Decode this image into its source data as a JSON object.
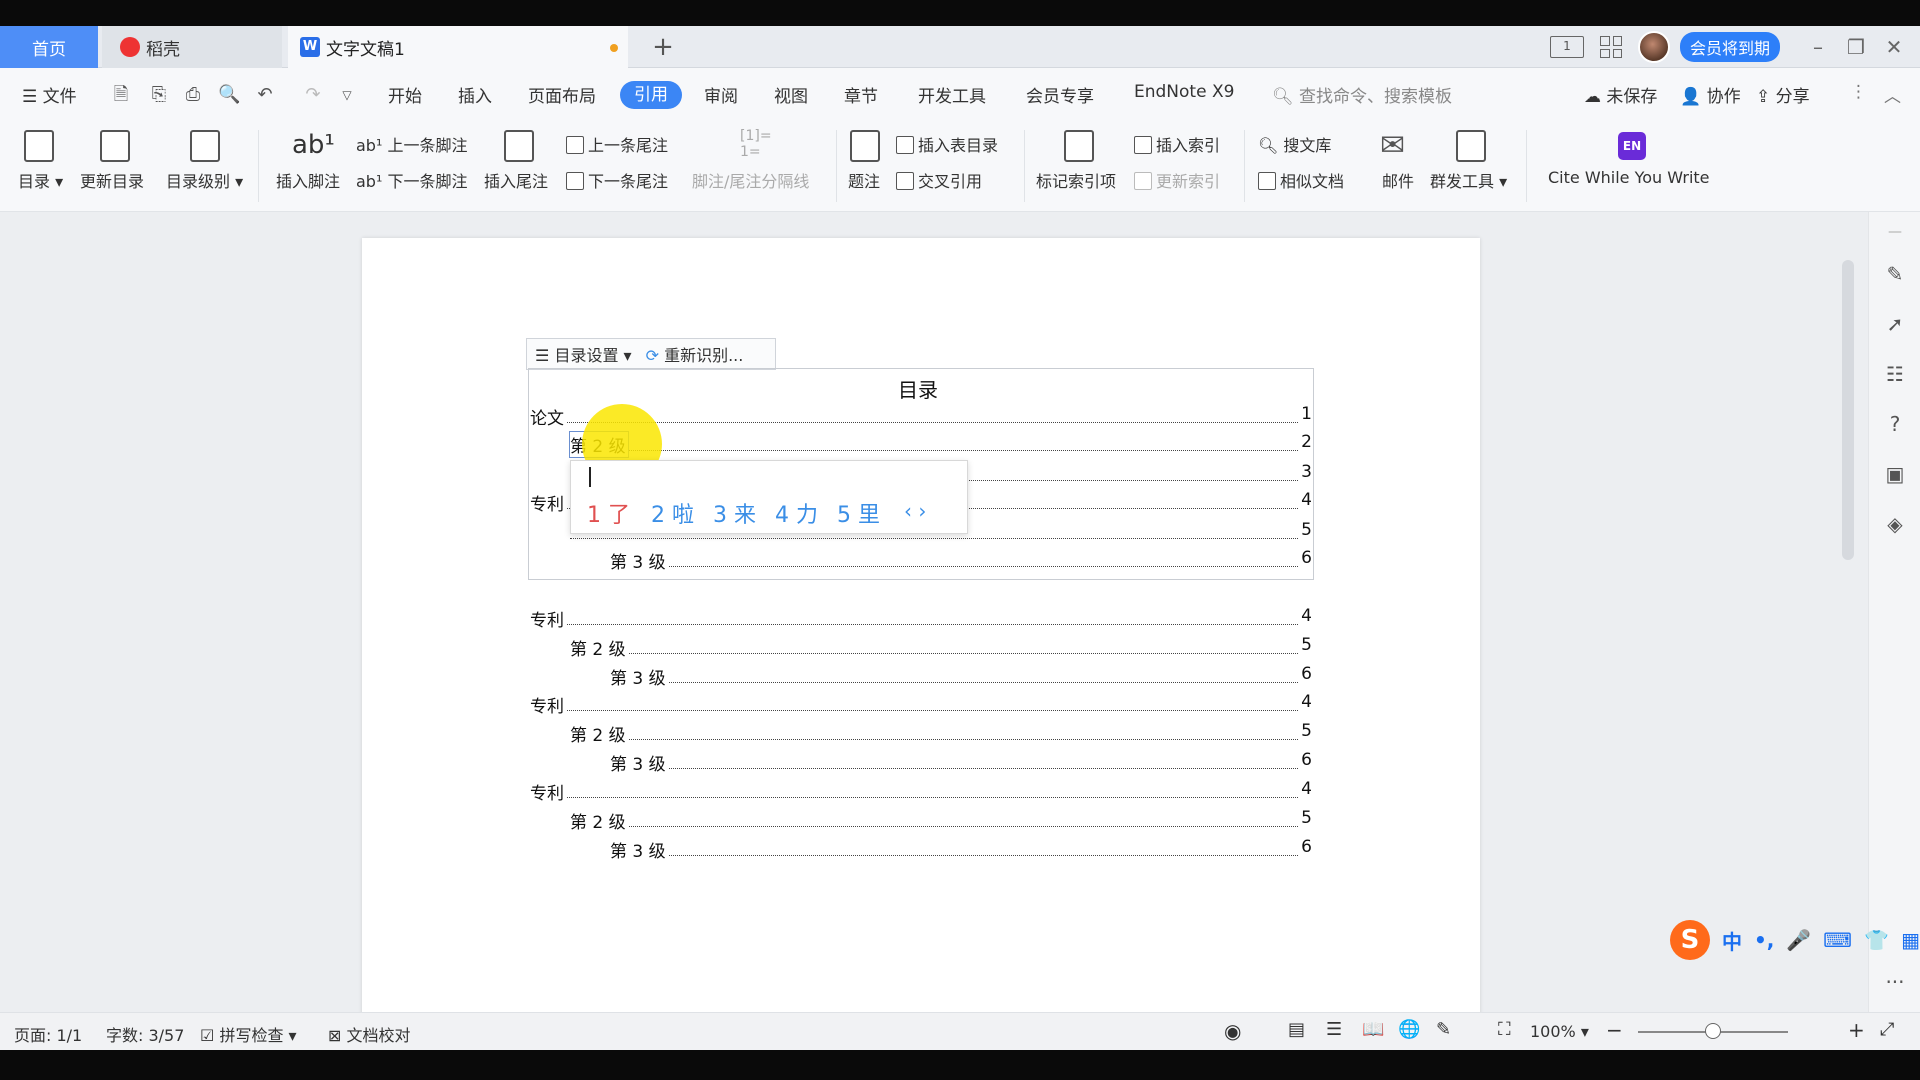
{
  "tabs": {
    "home": "首页",
    "daoke": "稻壳",
    "doc": "文字文稿1",
    "new_tab": "+"
  },
  "titlebar": {
    "member": "会员将到期",
    "layout_icon_label": "1"
  },
  "menu": {
    "file": "文件",
    "items": [
      "开始",
      "插入",
      "页面布局",
      "引用",
      "审阅",
      "视图",
      "章节",
      "开发工具",
      "会员专享",
      "EndNote X9"
    ],
    "active": "引用",
    "search_placeholder": "查找命令、搜索模板",
    "unsaved": "未保存",
    "collab": "协作",
    "share": "分享"
  },
  "ribbon": {
    "toc": "目录",
    "update_toc": "更新目录",
    "toc_level": "目录级别",
    "insert_footnote": "插入脚注",
    "prev_footnote": "上一条脚注",
    "next_footnote": "下一条脚注",
    "insert_endnote": "插入尾注",
    "prev_endnote": "上一条尾注",
    "next_endnote": "下一条尾注",
    "separator": "脚注/尾注分隔线",
    "caption": "题注",
    "insert_table_toc": "插入表目录",
    "cross_ref": "交叉引用",
    "mark_index": "标记索引项",
    "insert_index": "插入索引",
    "update_index": "更新索引",
    "search_lib": "搜文库",
    "similar_docs": "相似文档",
    "mail": "邮件",
    "mass_tool": "群发工具",
    "cite": "Cite While You Write",
    "en_icon": "EN"
  },
  "document": {
    "toc_settings": "目录设置",
    "reidentify": "重新识别...",
    "title": "目录",
    "entries": [
      {
        "text": "论文",
        "page": "1",
        "level": 1
      },
      {
        "text": "第 2 级",
        "page": "2",
        "level": 2
      },
      {
        "text": "",
        "page": "3",
        "level": 2
      },
      {
        "text": "专利",
        "page": "4",
        "level": 1
      },
      {
        "text": "",
        "page": "5",
        "level": 2
      },
      {
        "text": "第 3 级",
        "page": "6",
        "level": 3
      },
      {
        "text": "专利",
        "page": "4",
        "level": 1
      },
      {
        "text": "第 2 级",
        "page": "5",
        "level": 2
      },
      {
        "text": "第 3 级",
        "page": "6",
        "level": 3
      },
      {
        "text": "专利",
        "page": "4",
        "level": 1
      },
      {
        "text": "第 2 级",
        "page": "5",
        "level": 2
      },
      {
        "text": "第 3 级",
        "page": "6",
        "level": 3
      },
      {
        "text": "专利",
        "page": "4",
        "level": 1
      },
      {
        "text": "第 2 级",
        "page": "5",
        "level": 2
      },
      {
        "text": "第 3 级",
        "page": "6",
        "level": 3
      }
    ]
  },
  "ime": {
    "candidates": [
      "1 了",
      "2 啦",
      "3 来",
      "4 力",
      "5 里"
    ],
    "next": "‹ ›",
    "bar": [
      "中",
      "•,",
      "🎤",
      "⌨",
      "👕",
      "▦"
    ]
  },
  "status": {
    "page": "页面: 1/1",
    "words": "字数: 3/57",
    "spell": "拼写检查",
    "proof": "文档校对",
    "zoom": "100%",
    "zoom_value": 0.5
  }
}
